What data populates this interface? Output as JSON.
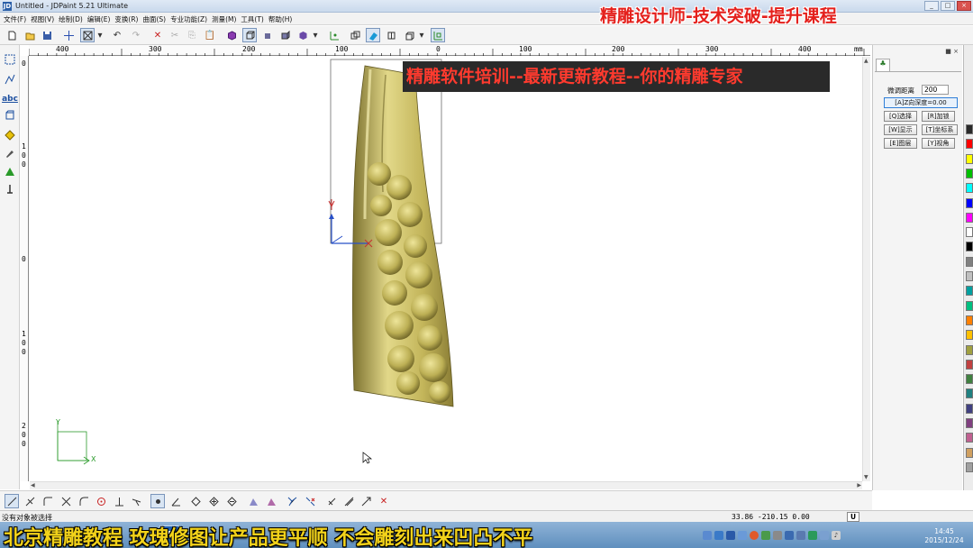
{
  "window": {
    "title": "Untitled - JDPaint 5.21 Ultimate",
    "app_icon": "JD",
    "controls": [
      "minimize-icon",
      "maximize-icon",
      "close-icon"
    ]
  },
  "menu": {
    "items": [
      "文件(F)",
      "视图(V)",
      "绘制(D)",
      "编辑(E)",
      "变换(R)",
      "曲面(S)",
      "专业功能(Z)",
      "测量(M)",
      "工具(T)",
      "帮助(H)"
    ]
  },
  "overlays": {
    "top_right": "精雕设计师-技术突破-提升课程",
    "banner": "精雕软件培训--最新更新教程--你的精雕专家",
    "bottom_caption": "北京精雕教程 玫瑰修图让产品更平顺 不会雕刻出来凹凸不平"
  },
  "ruler": {
    "h_labels": [
      "400",
      "300",
      "200",
      "100",
      "0",
      "100",
      "200",
      "300",
      "400",
      "mm"
    ],
    "v_labels": [
      "0",
      "1",
      "0",
      "0",
      "0",
      "1",
      "0",
      "0",
      "2",
      "0",
      "0"
    ]
  },
  "right_panel": {
    "fine_distance_label": "微调距离",
    "fine_distance_value": "200",
    "z_depth_button": "[A]Z向深度=0.00",
    "buttons": [
      "[Q]选择",
      "[R]加锁",
      "[W]显示",
      "[T]坐标系",
      "[E]图层",
      "[Y]视角"
    ]
  },
  "colors": {
    "swatches": [
      "#2a2a2a",
      "#ff0000",
      "#ffff00",
      "#00c000",
      "#00ffff",
      "#0000ff",
      "#ff00ff",
      "#ffffff",
      "#000000",
      "#808080",
      "#c0c0c0",
      "#00a0a0",
      "#00c080",
      "#ff8000",
      "#ffc000",
      "#a0a040",
      "#c04040",
      "#408040",
      "#208080",
      "#404080",
      "#804080",
      "#c06090",
      "#d0a060",
      "#a0a0a0"
    ],
    "model_gold": "#c9b95c",
    "axis_y": "#2850c8",
    "axis_x": "#c83030"
  },
  "status": {
    "message": "没有对象被选择",
    "coords": "33.86 -210.15 0.00",
    "unit": "U"
  },
  "taskbar": {
    "app_icon": "JD",
    "time": "14:45",
    "date": "2015/12/24"
  },
  "canvas": {
    "axis_x_label": "X",
    "axis_y_label": "Y"
  }
}
